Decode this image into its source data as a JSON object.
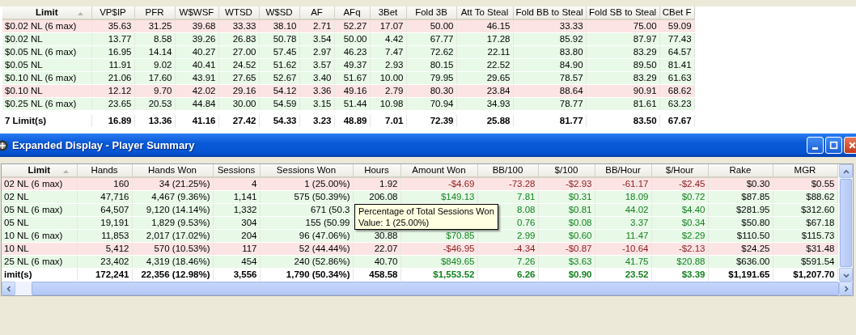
{
  "top_table": {
    "columns": [
      {
        "label": "Limit",
        "sorted": true
      },
      {
        "label": "VP$IP"
      },
      {
        "label": "PFR"
      },
      {
        "label": "W$WSF"
      },
      {
        "label": "WTSD"
      },
      {
        "label": "W$SD"
      },
      {
        "label": "AF"
      },
      {
        "label": "AFq"
      },
      {
        "label": "3Bet"
      },
      {
        "label": "Fold 3B"
      },
      {
        "label": "Att To Steal"
      },
      {
        "label": "Fold BB to Steal"
      },
      {
        "label": "Fold SB to Steal"
      },
      {
        "label": "CBet F"
      }
    ],
    "rows": [
      {
        "losing": true,
        "cells": [
          "$0.02 NL (6 max)",
          "35.63",
          "31.25",
          "39.68",
          "33.33",
          "38.10",
          "2.71",
          "52.27",
          "17.07",
          "50.00",
          "46.15",
          "33.33",
          "75.00",
          "59.09"
        ]
      },
      {
        "losing": false,
        "cells": [
          "$0.02 NL",
          "13.77",
          "8.58",
          "39.26",
          "26.83",
          "50.78",
          "3.54",
          "50.00",
          "4.42",
          "67.77",
          "17.28",
          "85.92",
          "87.97",
          "77.43"
        ]
      },
      {
        "losing": false,
        "cells": [
          "$0.05 NL (6 max)",
          "16.95",
          "14.14",
          "40.27",
          "27.00",
          "57.45",
          "2.97",
          "46.23",
          "7.47",
          "72.62",
          "22.11",
          "83.80",
          "83.29",
          "64.57"
        ]
      },
      {
        "losing": false,
        "cells": [
          "$0.05 NL",
          "11.91",
          "9.02",
          "40.41",
          "24.52",
          "51.62",
          "3.57",
          "49.37",
          "2.93",
          "80.15",
          "22.52",
          "84.90",
          "89.50",
          "81.41"
        ]
      },
      {
        "losing": false,
        "cells": [
          "$0.10 NL (6 max)",
          "21.06",
          "17.60",
          "43.91",
          "27.65",
          "52.67",
          "3.40",
          "51.67",
          "10.00",
          "79.95",
          "29.65",
          "78.57",
          "83.29",
          "61.63"
        ]
      },
      {
        "losing": true,
        "cells": [
          "$0.10 NL",
          "12.12",
          "9.70",
          "42.02",
          "29.16",
          "54.12",
          "3.36",
          "49.16",
          "2.79",
          "80.30",
          "23.84",
          "88.64",
          "90.91",
          "68.62"
        ]
      },
      {
        "losing": false,
        "cells": [
          "$0.25 NL (6 max)",
          "23.65",
          "20.53",
          "44.84",
          "30.00",
          "54.59",
          "3.15",
          "51.44",
          "10.98",
          "70.94",
          "34.93",
          "78.77",
          "81.61",
          "63.23"
        ]
      }
    ],
    "total": {
      "cells": [
        "7 Limit(s)",
        "16.89",
        "13.36",
        "41.16",
        "27.42",
        "54.33",
        "3.23",
        "48.89",
        "7.01",
        "72.39",
        "25.88",
        "81.77",
        "83.50",
        "67.67"
      ]
    }
  },
  "window": {
    "title": "Expanded Display - Player Summary"
  },
  "table": {
    "columns": [
      {
        "label": "Limit",
        "sorted": true,
        "colored": false
      },
      {
        "label": "Hands",
        "colored": false
      },
      {
        "label": "Hands Won",
        "colored": false
      },
      {
        "label": "Sessions",
        "colored": false
      },
      {
        "label": "Sessions Won",
        "colored": false
      },
      {
        "label": "Hours",
        "colored": false
      },
      {
        "label": "Amount Won",
        "colored": true
      },
      {
        "label": "BB/100",
        "colored": true
      },
      {
        "label": "$/100",
        "colored": true
      },
      {
        "label": "BB/Hour",
        "colored": true
      },
      {
        "label": "$/Hour",
        "colored": true
      },
      {
        "label": "Rake",
        "colored": false
      },
      {
        "label": "MGR",
        "colored": false
      }
    ],
    "rows": [
      {
        "losing": true,
        "cells": [
          "02 NL (6 max)",
          "160",
          "34 (21.25%)",
          "4",
          "1 (25.00%)",
          "1.92",
          "-$4.69",
          "-73.28",
          "-$2.93",
          "-61.17",
          "-$2.45",
          "$0.30",
          "$0.55"
        ]
      },
      {
        "losing": false,
        "cells": [
          "02 NL",
          "47,716",
          "4,467 (9.36%)",
          "1,141",
          "575 (50.39%)",
          "206.08",
          "$149.13",
          "7.81",
          "$0.31",
          "18.09",
          "$0.72",
          "$87.85",
          "$88.62"
        ]
      },
      {
        "losing": false,
        "cells": [
          "05 NL (6 max)",
          "64,507",
          "9,120 (14.14%)",
          "1,332",
          "671 (50.3",
          null,
          null,
          "8.08",
          "$0.81",
          "44.02",
          "$4.40",
          "$281.95",
          "$312.60"
        ]
      },
      {
        "losing": false,
        "cells": [
          "05 NL",
          "19,191",
          "1,829 (9.53%)",
          "304",
          "155 (50.99",
          null,
          null,
          "0.76",
          "$0.08",
          "3.37",
          "$0.34",
          "$50.80",
          "$67.18"
        ]
      },
      {
        "losing": false,
        "cells": [
          "10 NL (6 max)",
          "11,853",
          "2,017 (17.02%)",
          "204",
          "96 (47.06%)",
          "30.88",
          "$70.85",
          "2.99",
          "$0.60",
          "11.47",
          "$2.29",
          "$110.50",
          "$115.73"
        ]
      },
      {
        "losing": true,
        "cells": [
          "10 NL",
          "5,412",
          "570 (10.53%)",
          "117",
          "52 (44.44%)",
          "22.07",
          "-$46.95",
          "-4.34",
          "-$0.87",
          "-10.64",
          "-$2.13",
          "$24.25",
          "$31.48"
        ]
      },
      {
        "losing": false,
        "cells": [
          "25 NL (6 max)",
          "23,402",
          "4,319 (18.46%)",
          "454",
          "240 (52.86%)",
          "40.70",
          "$849.65",
          "7.26",
          "$3.63",
          "41.75",
          "$20.88",
          "$636.00",
          "$591.54"
        ]
      }
    ],
    "total": {
      "losing": false,
      "cells": [
        "imit(s)",
        "172,241",
        "22,356 (12.98%)",
        "3,556",
        "1,790 (50.34%)",
        "458.58",
        "$1,553.52",
        "6.26",
        "$0.90",
        "23.52",
        "$3.39",
        "$1,191.65",
        "$1,207.70"
      ]
    }
  },
  "tooltip": {
    "title": "Percentage of Total Sessions Won",
    "value": "Value: 1 (25.00%)"
  }
}
